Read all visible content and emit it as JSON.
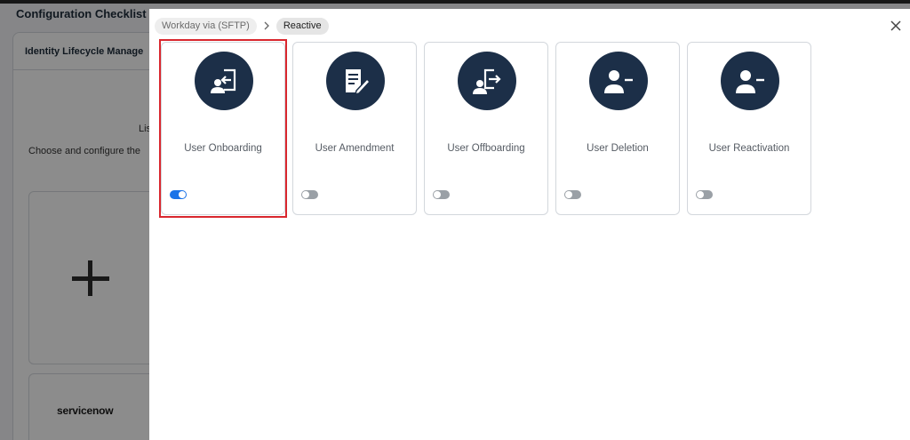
{
  "background": {
    "title": "Configuration Checklist a",
    "tab_label": "Identity Lifecycle Manage",
    "list_text": "Lis",
    "choose_text": "Choose and configure the",
    "servicenow_logo_text": "servicenow"
  },
  "modal": {
    "breadcrumbs": [
      {
        "label": "Workday via (SFTP)"
      },
      {
        "label": "Reactive"
      }
    ],
    "cards": [
      {
        "label": "User Onboarding",
        "icon": "user-onboarding-icon",
        "enabled": true,
        "selected": true
      },
      {
        "label": "User Amendment",
        "icon": "user-amendment-icon",
        "enabled": false,
        "selected": false
      },
      {
        "label": "User Offboarding",
        "icon": "user-offboarding-icon",
        "enabled": false,
        "selected": false
      },
      {
        "label": "User Deletion",
        "icon": "user-deletion-icon",
        "enabled": false,
        "selected": false
      },
      {
        "label": "User Reactivation",
        "icon": "user-reactivation-icon",
        "enabled": false,
        "selected": false
      }
    ]
  },
  "colors": {
    "icon_circle": "#1c2f48",
    "toggle_on": "#1a73e8",
    "toggle_off": "#9aa0a6",
    "selection_outline": "#d9272e"
  }
}
